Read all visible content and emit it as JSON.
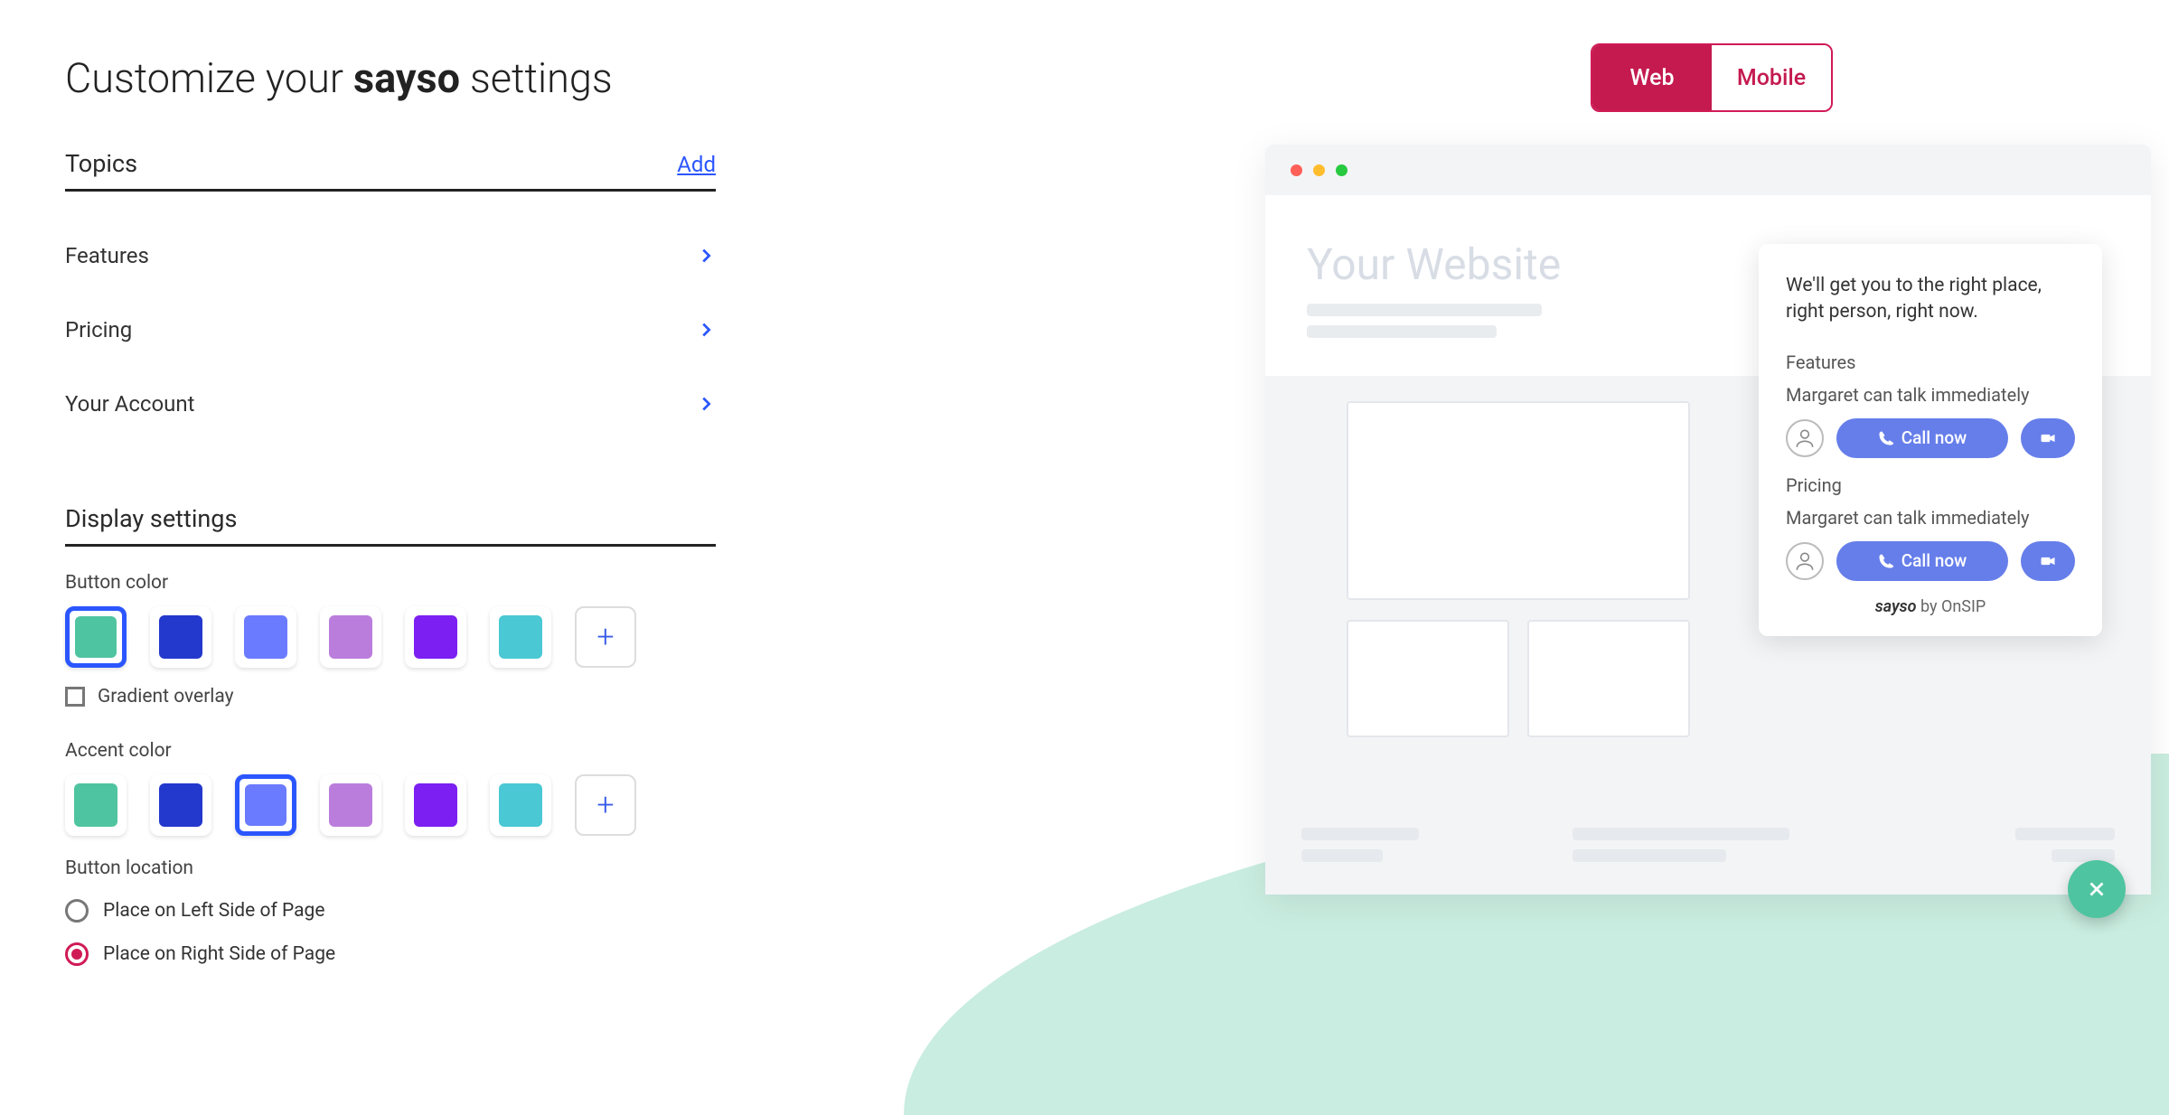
{
  "title_pre": "Customize your ",
  "title_bold": "sayso",
  "title_post": " settings",
  "topics_label": "Topics",
  "add_label": "Add",
  "topics": [
    "Features",
    "Pricing",
    "Your Account"
  ],
  "display_label": "Display settings",
  "button_color_label": "Button color",
  "gradient_label": "Gradient overlay",
  "accent_color_label": "Accent color",
  "button_location_label": "Button location",
  "location_options": [
    "Place on Left Side of Page",
    "Place on Right Side of Page"
  ],
  "location_selected": 1,
  "colors": [
    "#4fc4a0",
    "#2338cc",
    "#6a7bff",
    "#bb7ddc",
    "#7b1ff2",
    "#4ac8d4"
  ],
  "button_color_selected": 0,
  "accent_color_selected": 2,
  "toggle": {
    "web": "Web",
    "mobile": "Mobile",
    "active": "web"
  },
  "preview": {
    "site_title": "Your Website",
    "widget_heading": "We'll get you to the right place, right person, right now.",
    "sections": [
      {
        "title": "Features",
        "sub": "Margaret can talk immediately",
        "cta": "Call now"
      },
      {
        "title": "Pricing",
        "sub": "Margaret can talk immediately",
        "cta": "Call now"
      }
    ],
    "footer_brand": "sayso",
    "footer_by": " by OnSIP"
  }
}
